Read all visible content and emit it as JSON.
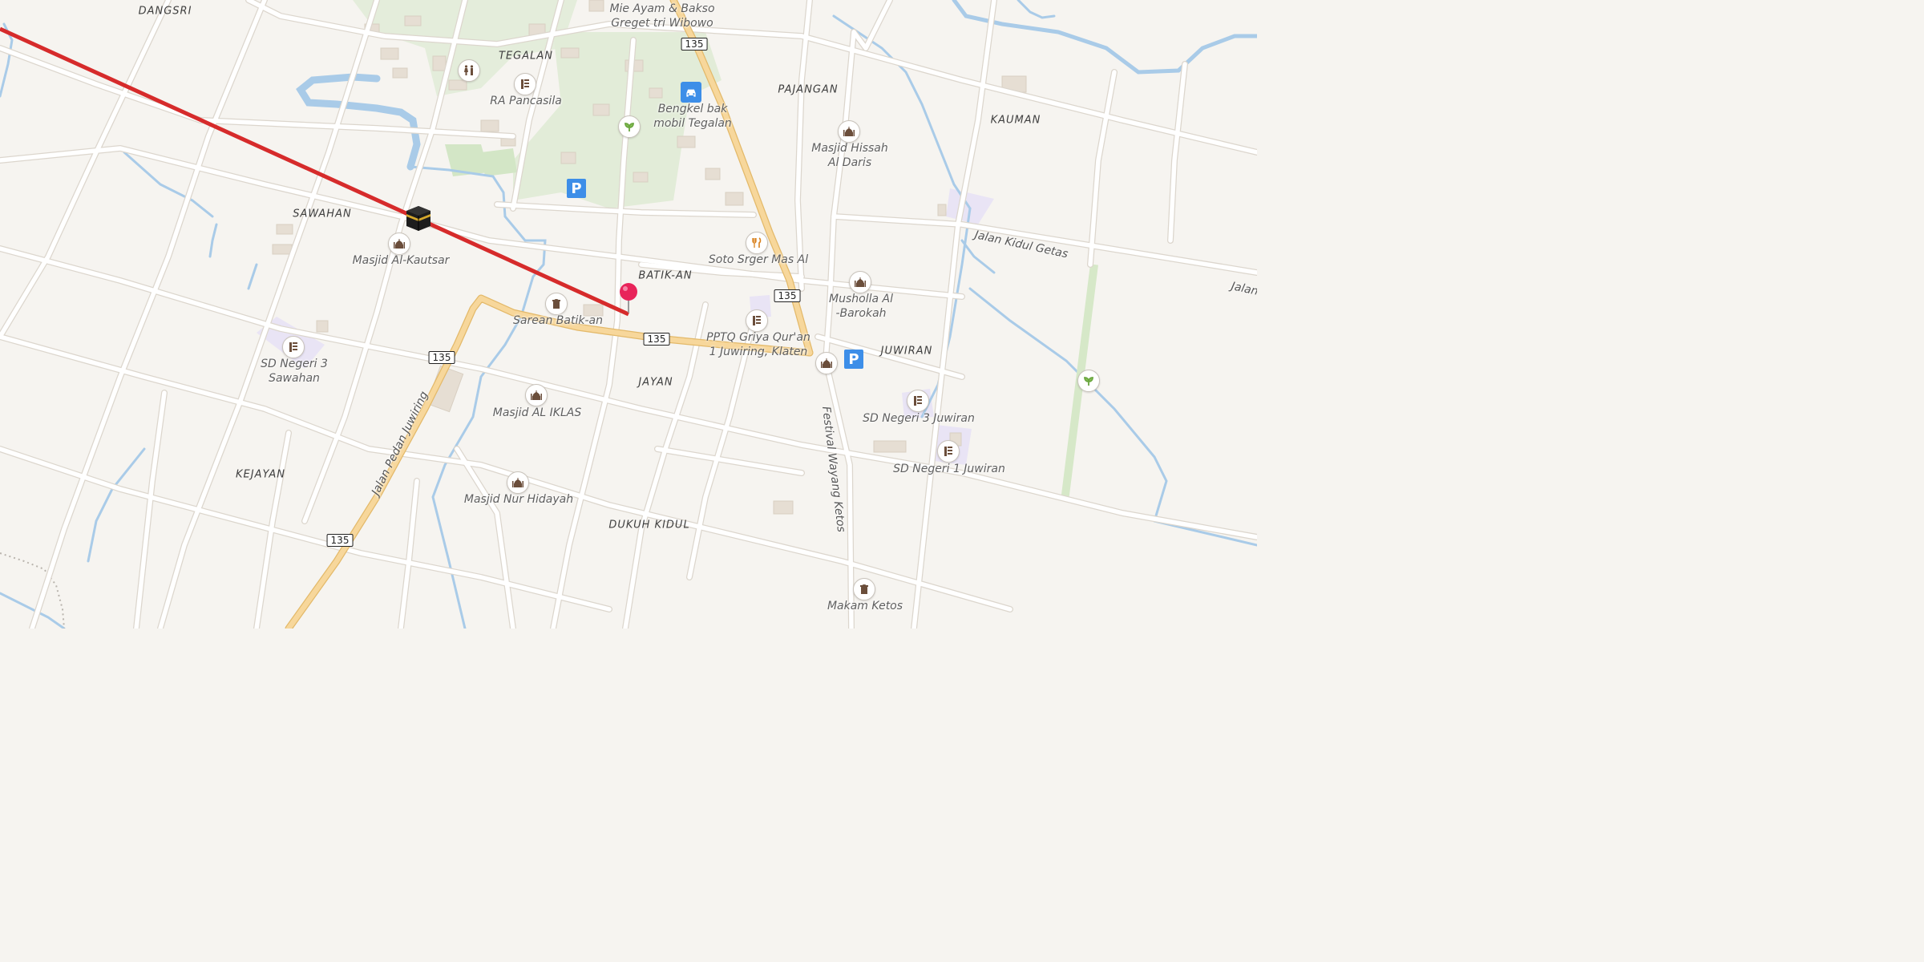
{
  "map": {
    "areas": {
      "dangsri": "DANGSRI",
      "tegalan": "TEGALAN",
      "pajangan": "PAJANGAN",
      "kauman": "KAUMAN",
      "sawahan": "SAWAHAN",
      "batikan": "BATIK-AN",
      "juwiran": "JUWIRAN",
      "jayan": "JAYAN",
      "kejayan": "KEJAYAN",
      "dukuh_kidul": "DUKUH KIDUL"
    },
    "pois": {
      "mie_ayam_1": "Mie Ayam & Bakso",
      "mie_ayam_2": "Greget tri Wibowo",
      "ra_pancasila": "RA Pancasila",
      "bengkel_1": "Bengkel bak",
      "bengkel_2": "mobil Tegalan",
      "masjid_hissah_1": "Masjid Hissah",
      "masjid_hissah_2": "Al Daris",
      "masjid_kautsar": "Masjid Al-Kautsar",
      "soto": "Soto Srger Mas Al",
      "musholla_1": "Musholla Al",
      "musholla_2": "-Barokah",
      "sarean": "Sarean Batik-an",
      "pptq_1": "PPTQ Griya Qur'an",
      "pptq_2": "1 Juwiring, Klaten",
      "sd_sawahan_1": "SD Negeri 3",
      "sd_sawahan_2": "Sawahan",
      "masjid_iklas": "Masjid AL IKLAS",
      "sd_juwiran_3": "SD Negeri 3 Juwiran",
      "sd_juwiran_1": "SD Negeri 1 Juwiran",
      "masjid_nur": "Masjid Nur Hidayah",
      "makam_ketos": "Makam Ketos"
    },
    "streets": {
      "kidul_getas": "Jalan Kidul Getas",
      "kidul_getas_cut": "Jalan",
      "pedan_juwiring": "Jalan Pedan Juwiring",
      "festival": "Festival Wayang Ketos"
    },
    "route_shield": "135",
    "parking_symbol": "P",
    "icons": {
      "toilet": "toilets-icon",
      "school": "school-icon",
      "car_repair": "car-repair-icon",
      "garden": "garden-icon",
      "parking": "parking-icon",
      "mosque": "mosque-icon",
      "restaurant": "restaurant-icon",
      "cemetery": "cemetery-icon",
      "kaaba": "qibla-kaaba-icon",
      "pin": "location-pin-icon"
    },
    "colors": {
      "background": "#f6f4f0",
      "road": "#ffffff",
      "main_road": "#f7d79b",
      "main_road_casing": "#e3b96a",
      "water": "#a9cbe8",
      "park": "#dbead0",
      "school_area": "#e8e3f4",
      "qibla_line": "#d62b2b",
      "pin": "#e8245a",
      "parking": "#3d8ee8"
    }
  }
}
